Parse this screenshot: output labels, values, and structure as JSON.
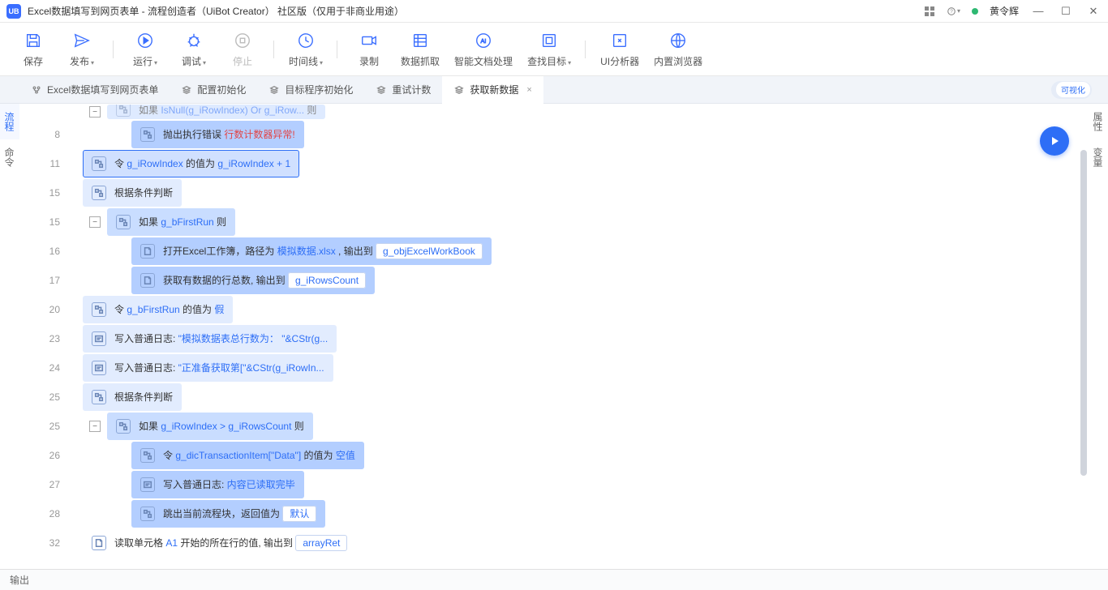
{
  "window": {
    "title": "Excel数据填写到网页表单 - 流程创造者（UiBot Creator） 社区版（仅用于非商业用途）",
    "username": "黄令辉"
  },
  "toolbar": {
    "save": "保存",
    "publish": "发布",
    "run": "运行",
    "debug": "调试",
    "stop": "停止",
    "timeline": "时间线",
    "record": "录制",
    "data_scrape": "数据抓取",
    "smart_doc": "智能文档处理",
    "find_target": "查找目标",
    "ui_analyzer": "UI分析器",
    "builtin_browser": "内置浏览器"
  },
  "tabs": [
    {
      "label": "Excel数据填写到网页表单"
    },
    {
      "label": "配置初始化"
    },
    {
      "label": "目标程序初始化"
    },
    {
      "label": "重试计数"
    },
    {
      "label": "获取新数据",
      "active": true
    }
  ],
  "visual_toggle": "可视化",
  "side": {
    "flow": "流程",
    "cmd": "命令"
  },
  "right_side": {
    "prop": "属性",
    "var": "变量"
  },
  "editor": {
    "rows": [
      {
        "ln": "",
        "indent": 1,
        "bg": "blue-mid",
        "fold": true,
        "partial": true,
        "icon": "flow",
        "parts": [
          {
            "t": "如果 ",
            "c": ""
          },
          {
            "t": "IsNull(g_iRowIndex) Or g_iRow...",
            "c": "kw"
          },
          {
            "t": " 则",
            "c": ""
          }
        ]
      },
      {
        "ln": "8",
        "indent": 2,
        "bg": "blue-dark",
        "icon": "flow",
        "parts": [
          {
            "t": "抛出执行错误 ",
            "c": ""
          },
          {
            "t": "行数计数器异常!",
            "c": "err"
          }
        ]
      },
      {
        "ln": "11",
        "indent": 0,
        "bg": "selected",
        "icon": "flow",
        "parts": [
          {
            "t": "令 ",
            "c": ""
          },
          {
            "t": "g_iRowIndex",
            "c": "kw"
          },
          {
            "t": " 的值为 ",
            "c": ""
          },
          {
            "t": "g_iRowIndex + 1",
            "c": "kw"
          }
        ]
      },
      {
        "ln": "15",
        "indent": 0,
        "bg": "blue-light",
        "icon": "flow",
        "parts": [
          {
            "t": "根据条件判断",
            "c": ""
          }
        ]
      },
      {
        "ln": "15",
        "indent": 1,
        "bg": "blue-mid",
        "fold": true,
        "icon": "flow",
        "parts": [
          {
            "t": "如果 ",
            "c": ""
          },
          {
            "t": "g_bFirstRun",
            "c": "kw"
          },
          {
            "t": " 则",
            "c": ""
          }
        ]
      },
      {
        "ln": "16",
        "indent": 2,
        "bg": "blue-dark",
        "icon": "doc",
        "parts": [
          {
            "t": "打开Excel工作簿，路径为 ",
            "c": ""
          },
          {
            "t": "模拟数据.xlsx",
            "c": "kw"
          },
          {
            "t": " , 输出到 ",
            "c": ""
          },
          {
            "t": "g_objExcelWorkBook",
            "c": "chip"
          }
        ]
      },
      {
        "ln": "17",
        "indent": 2,
        "bg": "blue-dark",
        "icon": "doc",
        "parts": [
          {
            "t": "获取有数据的行总数, 输出到 ",
            "c": ""
          },
          {
            "t": "g_iRowsCount",
            "c": "chip"
          }
        ]
      },
      {
        "ln": "20",
        "indent": 0,
        "bg": "blue-light",
        "icon": "flow",
        "parts": [
          {
            "t": "令 ",
            "c": ""
          },
          {
            "t": "g_bFirstRun",
            "c": "kw"
          },
          {
            "t": " 的值为 ",
            "c": ""
          },
          {
            "t": "假",
            "c": "kw"
          }
        ]
      },
      {
        "ln": "23",
        "indent": 0,
        "bg": "blue-light",
        "icon": "log",
        "parts": [
          {
            "t": "写入普通日志: ",
            "c": ""
          },
          {
            "t": "\"模拟数据表总行数为： \"&CStr(g...",
            "c": "kw"
          }
        ]
      },
      {
        "ln": "24",
        "indent": 0,
        "bg": "blue-light",
        "icon": "log",
        "parts": [
          {
            "t": "写入普通日志: ",
            "c": ""
          },
          {
            "t": "\"正准备获取第[\"&CStr(g_iRowIn...",
            "c": "kw"
          }
        ]
      },
      {
        "ln": "25",
        "indent": 0,
        "bg": "blue-light",
        "icon": "flow",
        "parts": [
          {
            "t": "根据条件判断",
            "c": ""
          }
        ]
      },
      {
        "ln": "25",
        "indent": 1,
        "bg": "blue-mid",
        "fold": true,
        "icon": "flow",
        "parts": [
          {
            "t": "如果 ",
            "c": ""
          },
          {
            "t": "g_iRowIndex > g_iRowsCount",
            "c": "kw"
          },
          {
            "t": " 则",
            "c": ""
          }
        ]
      },
      {
        "ln": "26",
        "indent": 2,
        "bg": "blue-dark",
        "icon": "flow",
        "parts": [
          {
            "t": "令 ",
            "c": ""
          },
          {
            "t": "g_dicTransactionItem[\"Data\"]",
            "c": "kw"
          },
          {
            "t": " 的值为 ",
            "c": ""
          },
          {
            "t": "空值",
            "c": "kw"
          }
        ]
      },
      {
        "ln": "27",
        "indent": 2,
        "bg": "blue-dark",
        "icon": "log",
        "parts": [
          {
            "t": "写入普通日志: ",
            "c": ""
          },
          {
            "t": "内容已读取完毕",
            "c": "kw"
          }
        ]
      },
      {
        "ln": "28",
        "indent": 2,
        "bg": "blue-dark",
        "icon": "flow",
        "parts": [
          {
            "t": "跳出当前流程块，返回值为 ",
            "c": ""
          },
          {
            "t": "默认",
            "c": "chip"
          }
        ]
      },
      {
        "ln": "32",
        "indent": 0,
        "bg": "",
        "icon": "doc",
        "parts": [
          {
            "t": "读取单元格 ",
            "c": ""
          },
          {
            "t": "A1",
            "c": "kw"
          },
          {
            "t": " 开始的所在行的值, 输出到 ",
            "c": ""
          },
          {
            "t": "arrayRet",
            "c": "chip"
          }
        ]
      }
    ]
  },
  "status": {
    "output": "输出"
  }
}
